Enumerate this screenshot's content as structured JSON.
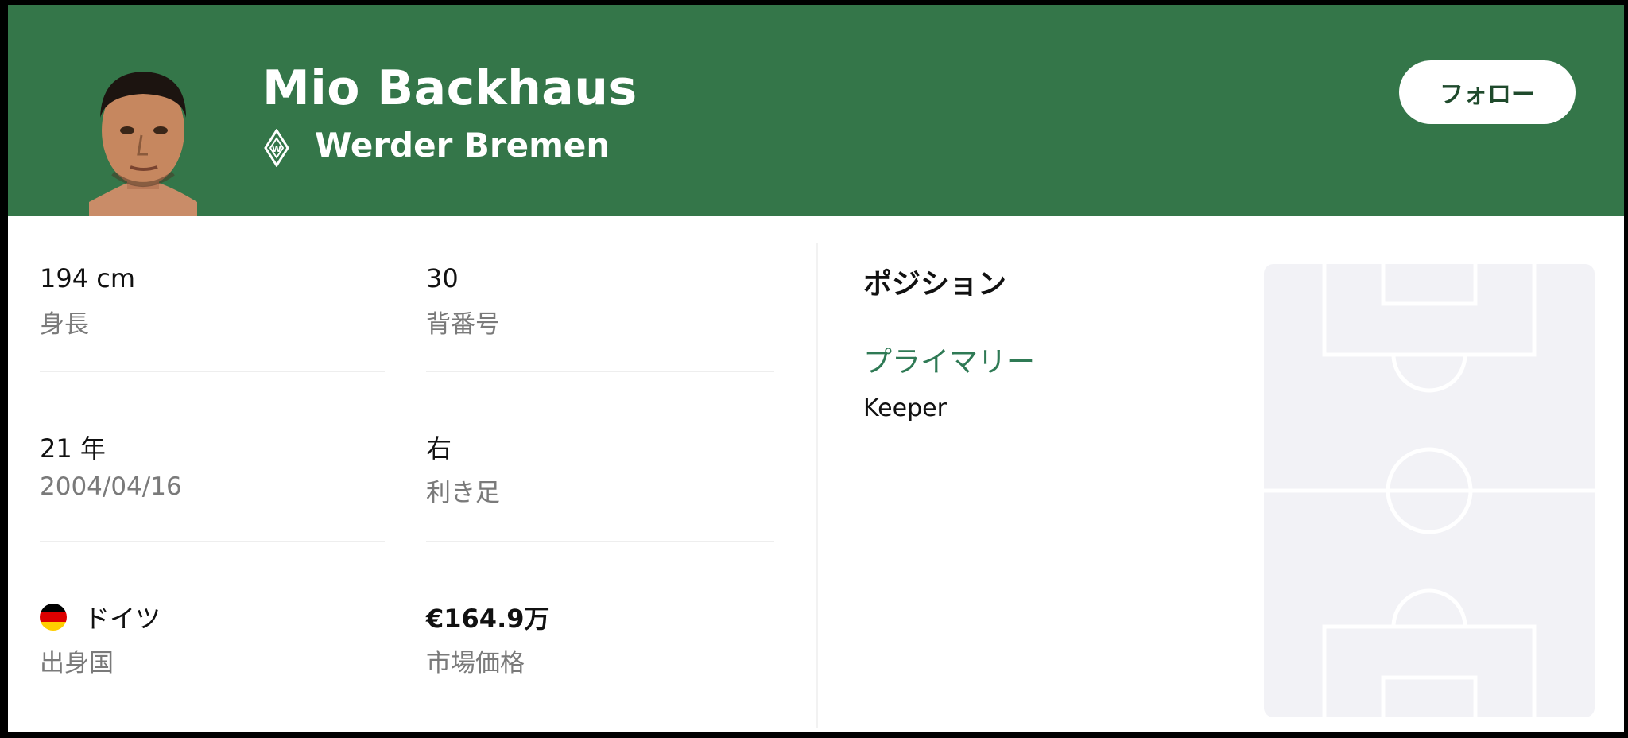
{
  "player": {
    "name": "Mio Backhaus",
    "club": "Werder Bremen",
    "follow_label": "フォロー",
    "avatar_icon": "player-photo",
    "club_icon": "werder-bremen-crest"
  },
  "stats": {
    "height": {
      "value": "194 cm",
      "label": "身長"
    },
    "shirt": {
      "value": "30",
      "label": "背番号"
    },
    "age": {
      "value": "21 年",
      "label": "2004/04/16"
    },
    "foot": {
      "value": "右",
      "label": "利き足"
    },
    "country": {
      "value": "ドイツ",
      "label": "出身国",
      "flag_icon": "germany-flag"
    },
    "market_value": {
      "value": "€164.9万",
      "label": "市場価格"
    }
  },
  "position": {
    "title": "ポジション",
    "primary_label": "プライマリー",
    "primary_value": "Keeper"
  },
  "colors": {
    "header_bg": "#347649",
    "accent_green": "#2f7a55",
    "pitch_bg": "#f2f2f6"
  }
}
